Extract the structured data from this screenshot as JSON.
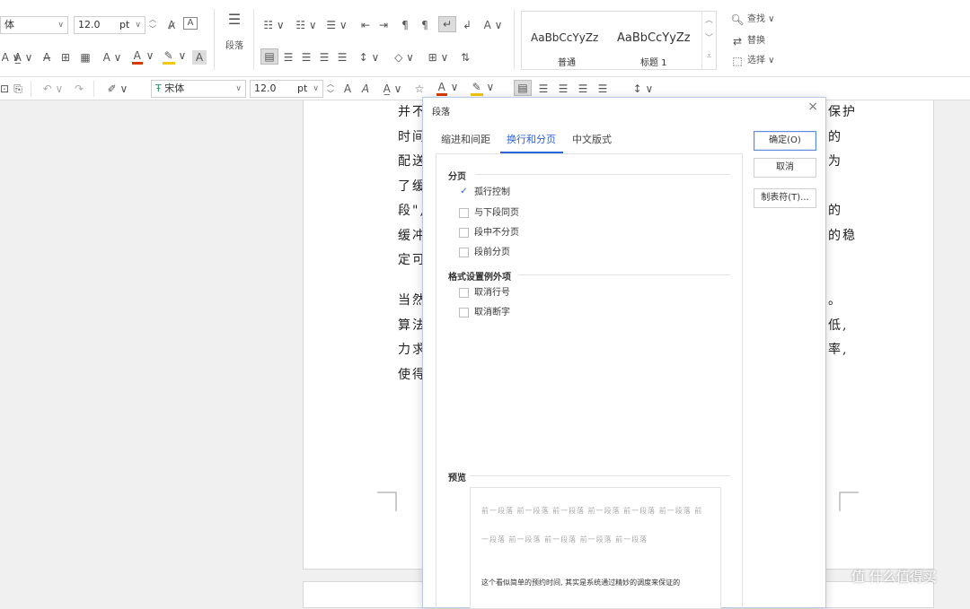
{
  "toolbar": {
    "font_name_partial": "体",
    "font_size": "12.0",
    "font_unit": "pt",
    "paragraph_label": "段落",
    "styles": [
      {
        "sample": "AaBbCcYyZz",
        "name": "普通"
      },
      {
        "sample": "AaBbCcYyZz",
        "name": "标题 1"
      }
    ],
    "find_label": "查找",
    "replace_label": "替换",
    "select_label": "选择",
    "accent_red": "#d83b01",
    "accent_yellow": "#f2c811"
  },
  "quickbar": {
    "font_name": "宋体",
    "font_size": "12.0",
    "font_unit": "pt"
  },
  "document": {
    "lines_left": [
      "并不",
      "时间",
      "配送",
      "了缓",
      "段\",",
      "缓冲",
      "定可",
      "当然",
      "算法",
      "力求",
      "使得"
    ],
    "lines_right": [
      "保护",
      "的",
      "为",
      "",
      "的",
      "的稳",
      "",
      "。",
      "低,",
      "率,",
      ""
    ]
  },
  "dialog": {
    "title": "段落",
    "close": "×",
    "tabs": [
      "缩进和间距",
      "换行和分页",
      "中文版式"
    ],
    "active_tab": 1,
    "section_pagination": "分页",
    "pagination_options": [
      {
        "label": "孤行控制",
        "checked": true
      },
      {
        "label": "与下段同页",
        "checked": false
      },
      {
        "label": "段中不分页",
        "checked": false
      },
      {
        "label": "段前分页",
        "checked": false
      }
    ],
    "section_format": "格式设置例外项",
    "format_options": [
      {
        "label": "取消行号",
        "checked": false
      },
      {
        "label": "取消断字",
        "checked": false
      }
    ],
    "ok_label": "确定(O)",
    "cancel_label": "取消",
    "tabs_button_label": "制表符(T)...",
    "section_preview": "预览",
    "preview_prev_line1": "前一段落  前一段落  前一段落  前一段落  前一段落  前一段落  前",
    "preview_prev_line2": "一段落  前一段落  前一段落  前一段落  前一段落",
    "preview_current": "这个看似简单的预约时间, 其实是系统通过精妙的调度来保证的"
  },
  "watermark": "值 什么值得买"
}
